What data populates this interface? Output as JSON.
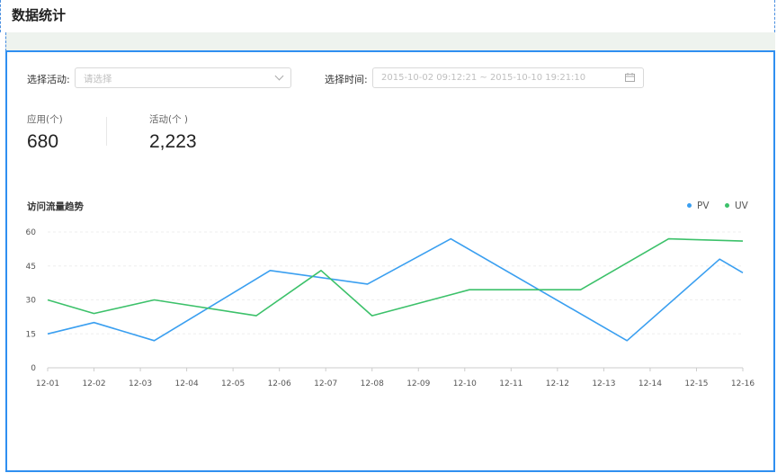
{
  "page": {
    "title": "数据统计"
  },
  "filters": {
    "activity_label": "选择活动:",
    "activity_placeholder": "请选择",
    "time_label": "选择时间:",
    "time_range": "2015-10-02 09:12:21 ~ 2015-10-10 19:21:10"
  },
  "stats": [
    {
      "label": "应用(个)",
      "value": "680"
    },
    {
      "label": "活动(个 )",
      "value": "2,223"
    }
  ],
  "colors": {
    "pv": "#3a9ff0",
    "uv": "#3cc16a",
    "accent": "#2f8ff0"
  },
  "chart_data": {
    "type": "line",
    "title": "访问流量趋势",
    "categories": [
      "12-01",
      "12-02",
      "12-03",
      "12-04",
      "12-05",
      "12-06",
      "12-07",
      "12-08",
      "12-09",
      "12-10",
      "12-11",
      "12-12",
      "12-13",
      "12-14",
      "12-15",
      "12-16"
    ],
    "ylim": [
      0,
      60
    ],
    "yticks": [
      0,
      15,
      30,
      45,
      60
    ],
    "grid": true,
    "legend_position": "top-right",
    "series": [
      {
        "name": "PV",
        "points": [
          [
            0,
            15
          ],
          [
            1,
            20
          ],
          [
            2.3,
            12
          ],
          [
            4.8,
            43
          ],
          [
            6.9,
            37
          ],
          [
            8.7,
            57
          ],
          [
            12.5,
            12
          ],
          [
            14.5,
            48
          ],
          [
            15,
            42
          ]
        ]
      },
      {
        "name": "UV",
        "points": [
          [
            0,
            30
          ],
          [
            1,
            24
          ],
          [
            2.3,
            30
          ],
          [
            4.5,
            23
          ],
          [
            5.9,
            43
          ],
          [
            7,
            23
          ],
          [
            9.1,
            34.5
          ],
          [
            11.5,
            34.5
          ],
          [
            13.4,
            57
          ],
          [
            15,
            56
          ]
        ]
      }
    ]
  }
}
